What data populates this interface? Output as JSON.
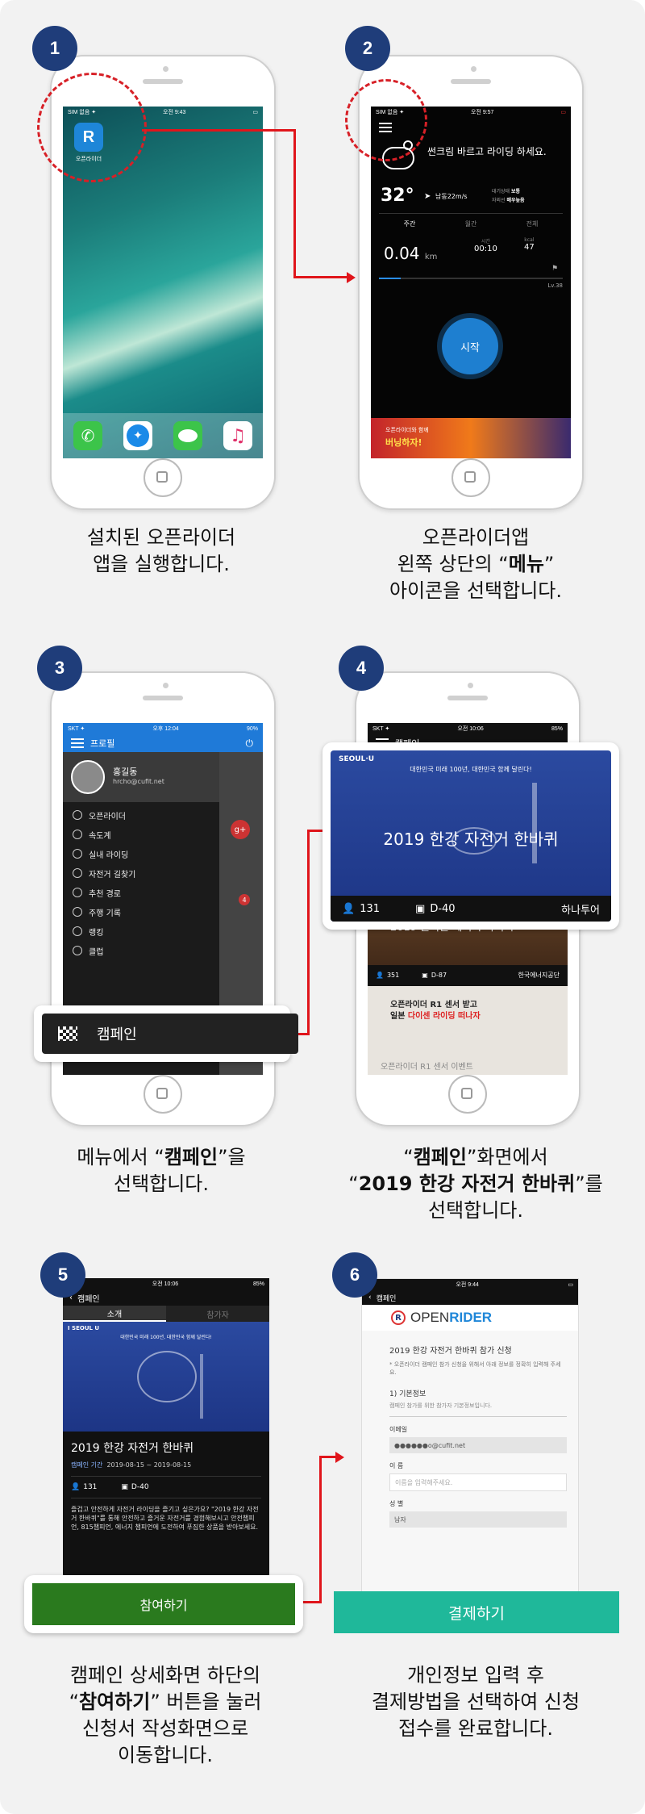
{
  "steps": [
    {
      "number": "1",
      "caption_line1": "설치된 오픈라이더",
      "caption_line2": "앱을 실행합니다."
    },
    {
      "number": "2",
      "caption_line1": "오픈라이더앱",
      "caption_line2_pre": "왼쪽 상단의 “",
      "caption_line2_bold": "메뉴",
      "caption_line2_post": "”",
      "caption_line3": "아이콘을 선택합니다."
    },
    {
      "number": "3",
      "caption_line1_pre": "메뉴에서 “",
      "caption_line1_bold": "캠페인",
      "caption_line1_post": "”을",
      "caption_line2": "선택합니다."
    },
    {
      "number": "4",
      "caption_line1_pre": "“",
      "caption_line1_bold": "캠페인",
      "caption_line1_post": "”화면에서",
      "caption_line2_pre": "“",
      "caption_line2_bold": "2019 한강 자전거 한바퀴",
      "caption_line2_post": "”를",
      "caption_line3": "선택합니다."
    },
    {
      "number": "5",
      "caption_line1": "캠페인 상세화면 하단의",
      "caption_line2_pre": "“",
      "caption_line2_bold": "참여하기",
      "caption_line2_post": "” 버튼을 눌러",
      "caption_line3": "신청서 작성화면으로",
      "caption_line4": "이동합니다."
    },
    {
      "number": "6",
      "caption_line1": "개인정보 입력 후",
      "caption_line2": "결제방법을 선택하여 신청",
      "caption_line3": "접수를 완료합니다."
    }
  ],
  "phone1": {
    "status_left": "SIM 없음 ✦",
    "status_time": "오전 9:43",
    "app_label": "오픈라이더",
    "app_letter": "R"
  },
  "phone2": {
    "status_left": "SIM 없음 ✦",
    "status_time": "오전 9:57",
    "weather_msg": "썬크림 바르고 라이딩 하세요.",
    "temp": "32°",
    "wind": "남동22m/s",
    "air1_label": "대기상태",
    "air1_val": "보통",
    "air2_label": "자외선",
    "air2_val": "매우높음",
    "tabs": [
      "주간",
      "월간",
      "전체"
    ],
    "distance": "0.04",
    "distance_unit": "km",
    "time_label": "시간",
    "time_val": "00:10",
    "kcal_label": "kcal",
    "kcal_val": "47",
    "level": "Lv.38",
    "start": "시작",
    "banner_line1": "오픈라이더와 함께",
    "banner_line2": "버닝하자!"
  },
  "phone3": {
    "status_left": "SKT ✦",
    "status_time": "오후 12:04",
    "status_right": "90%",
    "header_title": "프로필",
    "user_name": "홍길동",
    "user_email": "hrcho@cufit.net",
    "menu": [
      "오픈라이더",
      "속도계",
      "실내 라이딩",
      "자전거 길찾기",
      "추천 경로",
      "주행 기록",
      "랭킹",
      "클럽"
    ],
    "badge": "4",
    "callout": "캠페인"
  },
  "phone4": {
    "status_left": "SKT ✦",
    "status_time": "오전 10:06",
    "status_right": "85%",
    "header_title": "캠페인",
    "card1_brand": "SEOUL·U",
    "card1_tagline": "대한민국 미래 100년, 대한민국 함께 달린다!",
    "card1_title": "2019 한강 자전거 한바퀴",
    "card1_count": "131",
    "card1_dday": "D-40",
    "card1_org": "하나투어",
    "card2_title": "2019 출퇴근 에너지 라이더",
    "card2_count": "351",
    "card2_dday": "D-87",
    "card2_org": "한국에너지공단",
    "card3_line1": "오픈라이더 R1 센서 받고",
    "card3_line2_pre": "일본 ",
    "card3_line2_hl": "다이센 라이딩 떠나자",
    "card3_bottom": "오픈라이더 R1 센서 이벤트"
  },
  "phone5": {
    "status_left": "T ✦",
    "status_time": "오전 10:06",
    "status_right": "85%",
    "header_title": "캠페인",
    "tab_intro": "소개",
    "tab_part": "참가자",
    "banner_brand": "I SEOUL U",
    "banner_tagline": "대한민국 미래 100년, 대한민국 함께 달린다!",
    "title": "2019 한강 자전거 한바퀴",
    "period_label": "캠페인 기간",
    "period_val": "2019-08-15 ~ 2019-08-15",
    "count": "131",
    "dday": "D-40",
    "desc": "즐겁고 안전하게 자전거 라이딩을 즐기고 싶은가요? \"2019 한강 자전거 한바퀴\"를 통해 안전하고 즐거운 자전거를 경험해보시고 안전챔피언, 815챔피언, 에너지 챔피언에 도전하여 푸짐한 상품을 받아보세요.",
    "button": "참여하기"
  },
  "phone6": {
    "status_time": "오전 9:44",
    "header_title": "캠페인",
    "logo_text_a": "OPEN",
    "logo_text_b": "RIDER",
    "form_title": "2019 한강 자전거 한바퀴 참가 신청",
    "form_note": "* 오픈라이더 캠페인 참가 신청을 위해서 아래 정보를 정확히 입력해 주세요.",
    "section1": "1) 기본정보",
    "section1_note": "캠페인 참가를 위한 참가자 기본정보입니다.",
    "email_label": "이메일",
    "email_val": "●●●●●●o@cufit.net",
    "name_label": "이 름",
    "name_placeholder": "이름을 입력해주세요.",
    "gender_label": "성 별",
    "gender_val": "남자",
    "pay_button": "결제하기"
  },
  "colors": {
    "step": "#1f3d7a",
    "red": "#e0151b",
    "green": "#2a7a1e",
    "teal": "#1fb89a",
    "blue_card": "#2b4aa0",
    "dark": "#1b1b1b"
  }
}
